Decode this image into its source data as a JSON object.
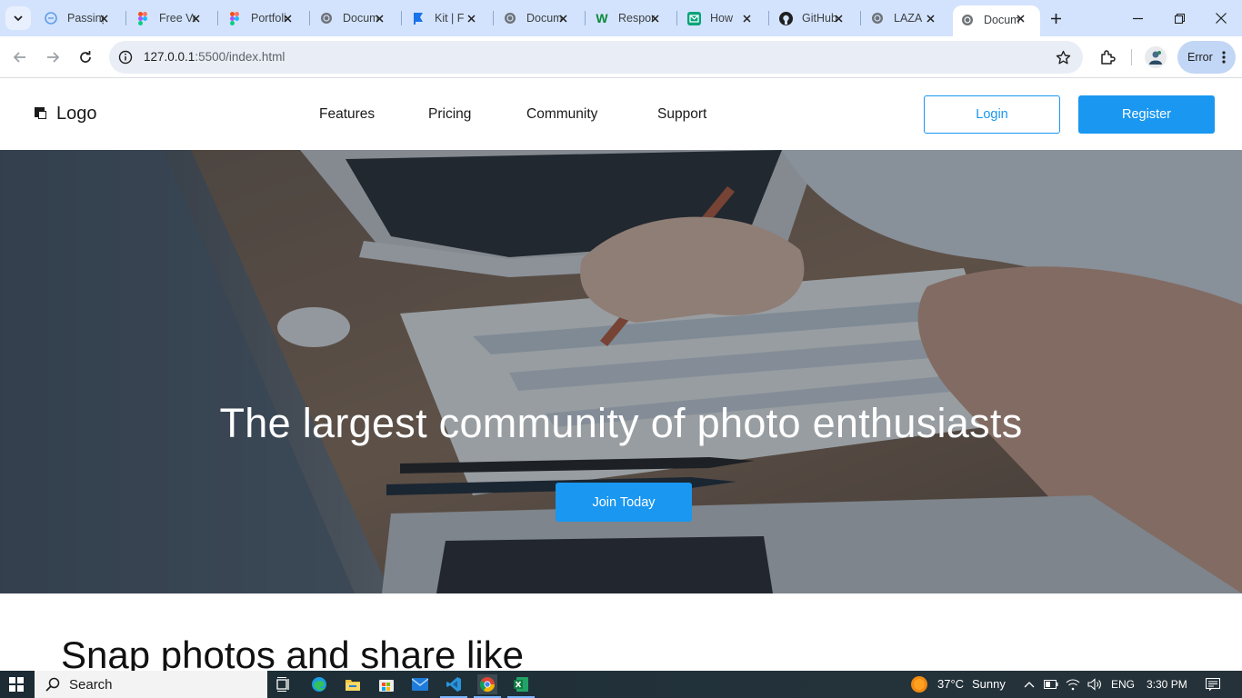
{
  "browser": {
    "tabs": [
      {
        "title": "Passing",
        "icon": "globe-icon",
        "color": "#5f9de8"
      },
      {
        "title": "Free Vector",
        "icon": "figma-icon",
        "color": "#f24e1e"
      },
      {
        "title": "Portfolio",
        "icon": "figma-icon",
        "color": "#f24e1e"
      },
      {
        "title": "Document",
        "icon": "globe-icon",
        "color": "#5f6368"
      },
      {
        "title": "Kit | F",
        "icon": "flag-icon",
        "color": "#1a73e8"
      },
      {
        "title": "Document",
        "icon": "globe-icon",
        "color": "#5f6368"
      },
      {
        "title": "Responsive",
        "icon": "w-icon",
        "color": "#0a8a3a"
      },
      {
        "title": "How",
        "icon": "mail-icon",
        "color": "#00a37a"
      },
      {
        "title": "GitHub",
        "icon": "github-icon",
        "color": "#1f1f1f"
      },
      {
        "title": "LAZA",
        "icon": "globe-icon",
        "color": "#5f6368"
      },
      {
        "title": "Document",
        "icon": "globe-icon",
        "color": "#5f6368",
        "active": true
      }
    ],
    "url_host": "127.0.0.1",
    "url_path": ":5500/index.html",
    "error_label": "Error"
  },
  "site": {
    "logo_text": "Logo",
    "nav": [
      "Features",
      "Pricing",
      "Community",
      "Support"
    ],
    "login_label": "Login",
    "register_label": "Register",
    "hero_title": "The largest community of photo enthusiasts",
    "join_label": "Join Today",
    "section_title": "Snap photos and share like",
    "accent_color": "#1a97f0"
  },
  "taskbar": {
    "search_label": "Search",
    "weather_temp": "37°C",
    "weather_text": "Sunny",
    "language": "ENG",
    "time": "3:30 PM"
  }
}
